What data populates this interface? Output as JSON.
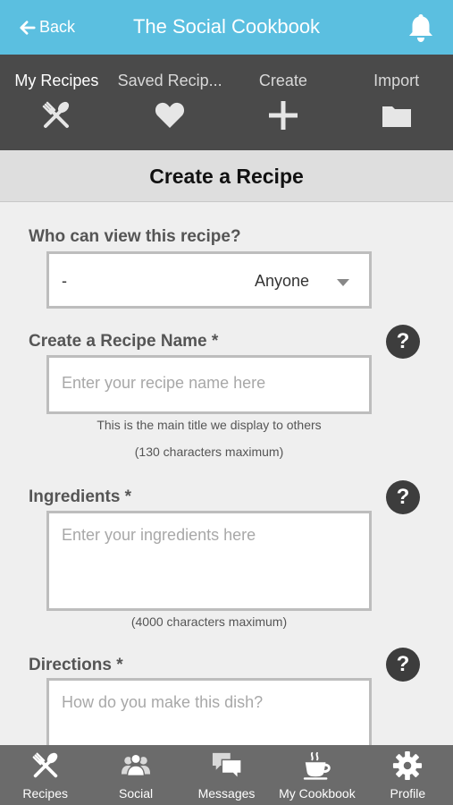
{
  "header": {
    "back_label": "Back",
    "title": "The Social Cookbook",
    "notification_icon": "bell-icon",
    "color": "#5bbfe0"
  },
  "tabs": [
    {
      "label": "My Recipes",
      "icon": "utensils-icon",
      "active": true
    },
    {
      "label": "Saved Recip...",
      "icon": "heart-icon",
      "active": false
    },
    {
      "label": "Create",
      "icon": "plus-icon",
      "active": false
    },
    {
      "label": "Import",
      "icon": "folder-icon",
      "active": false
    }
  ],
  "section": {
    "title": "Create a Recipe"
  },
  "form": {
    "visibility": {
      "label": "Who can view this recipe?",
      "dash": "-",
      "selected": "Anyone"
    },
    "name": {
      "label": "Create a Recipe Name *",
      "placeholder": "Enter your recipe name here",
      "hint1": "This is the main title we display to others",
      "hint2": "(130 characters maximum)"
    },
    "ingredients": {
      "label": "Ingredients *",
      "placeholder": "Enter your ingredients here",
      "hint": "(4000 characters maximum)"
    },
    "directions": {
      "label": "Directions *",
      "placeholder": "How do you make this dish?"
    },
    "help_symbol": "?"
  },
  "bottom_nav": [
    {
      "label": "Recipes",
      "icon": "utensils-icon"
    },
    {
      "label": "Social",
      "icon": "people-icon"
    },
    {
      "label": "Messages",
      "icon": "chat-icon"
    },
    {
      "label": "My Cookbook",
      "icon": "cup-icon"
    },
    {
      "label": "Profile",
      "icon": "gear-icon"
    }
  ]
}
